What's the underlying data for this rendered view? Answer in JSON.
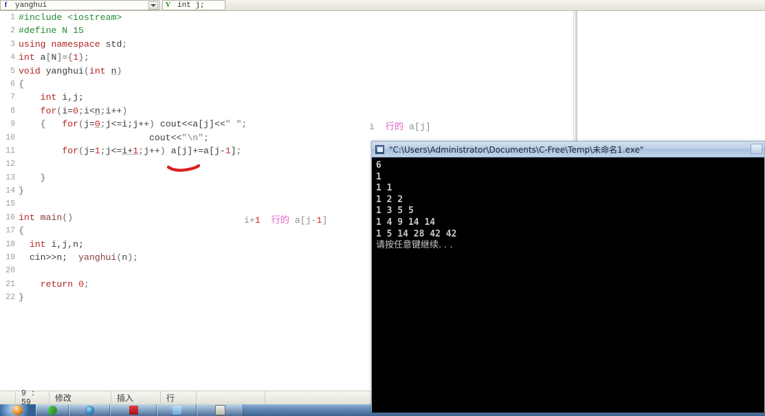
{
  "toolbar": {
    "function_combo": {
      "icon": "function-icon",
      "icon_glyph": "f",
      "value": "yanghui"
    },
    "declaration_combo": {
      "icon": "variable-icon",
      "icon_glyph": "V",
      "value": "int j;"
    },
    "dropdown_arrow": "chevron-down-icon"
  },
  "editor": {
    "lines": [
      {
        "num": "1",
        "html": "<span class='pre'>#include &lt;iostream&gt;</span>"
      },
      {
        "num": "2",
        "html": "<span class='pre'>#define N 15</span>"
      },
      {
        "num": "3",
        "html": "<span class='kw'>using namespace</span> <span class='id'>std</span><span class='pun'>;</span>"
      },
      {
        "num": "4",
        "html": "<span class='kw'>int</span> <span class='id'>a</span><span class='pun'>[</span><span class='id'>N</span><span class='pun'>]={</span><span class='num'>1</span><span class='pun'>};</span>"
      },
      {
        "num": "5",
        "html": "<span class='kw'>void</span> <span class='id'>yanghui</span><span class='pun'>(</span><span class='kw'>int</span> <span class='id und'>n</span><span class='pun'>)</span>"
      },
      {
        "num": "6",
        "html": "<span class='pun'>{</span>"
      },
      {
        "num": "7",
        "html": "    <span class='kw'>int</span> <span class='id'>i,j;</span>"
      },
      {
        "num": "8",
        "html": "    <span class='kw'>for</span><span class='pun'>(</span><span class='id'>i=</span><span class='num'>0</span><span class='pun'>;</span><span class='id'>i&lt;</span><span class='id und'>n</span><span class='pun'>;</span><span class='id'>i++</span><span class='pun'>)</span>"
      },
      {
        "num": "9",
        "html": "    <span class='pun'>{</span>   <span class='kw'>for</span><span class='pun'>(</span><span class='id'>j=</span><span class='num und'>0</span><span class='pun'>;</span><span class='id'>j&lt;=i;j++</span><span class='pun'>)</span> <span class='id'>cout&lt;&lt;a[j]&lt;&lt;</span><span class='str'>\" \"</span><span class='pun'>;</span>"
      },
      {
        "num": "10",
        "html": "                        <span class='id'>cout&lt;&lt;</span><span class='str'>\"\\n\"</span><span class='pun'>;</span>"
      },
      {
        "num": "11",
        "html": "        <span class='kw'>for</span><span class='pun'>(</span><span class='id'>j=</span><span class='num'>1</span><span class='pun'>;</span><span class='id'>j&lt;=</span><span class='id und'>i+</span><span class='num und'>1</span><span class='pun'>;</span><span class='id'>j++</span><span class='pun'>)</span> <span class='id'>a[j]+=a[j-</span><span class='num'>1</span><span class='id'>]</span><span class='pun'>;</span>"
      },
      {
        "num": "12",
        "html": ""
      },
      {
        "num": "13",
        "html": "    <span class='pun'>}</span>"
      },
      {
        "num": "14",
        "html": "<span class='pun'>}</span>"
      },
      {
        "num": "15",
        "html": ""
      },
      {
        "num": "16",
        "html": "<span class='kw'>int</span> <span class='fn'>main</span><span class='pun'>()</span>"
      },
      {
        "num": "17",
        "html": "<span class='pun'>{</span>"
      },
      {
        "num": "18",
        "html": "  <span class='kw'>int</span> <span class='id'>i,j,n;</span>"
      },
      {
        "num": "19",
        "html": "  <span class='id'>cin&gt;&gt;n;</span>  <span class='fn'>yanghui</span><span class='pun'>(</span><span class='id'>n</span><span class='pun'>);</span>"
      },
      {
        "num": "20",
        "html": ""
      },
      {
        "num": "21",
        "html": "    <span class='kw'>return</span> <span class='num'>0</span><span class='pun'>;</span>"
      },
      {
        "num": "22",
        "html": "<span class='pun'>}</span>"
      }
    ],
    "annotations": [
      {
        "name": "annotation-line9",
        "parts": [
          {
            "text": "i",
            "cls": "an-grey"
          },
          {
            "text": "  行的 ",
            "cls": "an-pink"
          },
          {
            "text": "a[j]",
            "cls": "an-grey"
          }
        ]
      },
      {
        "name": "annotation-line16",
        "parts": [
          {
            "text": "i+",
            "cls": "an-grey"
          },
          {
            "text": "1",
            "cls": "an-red"
          },
          {
            "text": "  行的 ",
            "cls": "an-pink"
          },
          {
            "text": "a[j-",
            "cls": "an-grey"
          },
          {
            "text": "1",
            "cls": "an-red"
          },
          {
            "text": "]",
            "cls": "an-grey"
          }
        ]
      }
    ],
    "red_underline_color": "#d92020"
  },
  "statusbar": {
    "position": "9 : 59",
    "modified": "修改",
    "insert_mode": "插入",
    "row_mode": "行",
    "blank": ""
  },
  "console": {
    "icon": "console-window-icon",
    "title": "\"C:\\Users\\Administrator\\Documents\\C-Free\\Temp\\未命名1.exe\"",
    "buttons": [
      "minimize-button"
    ],
    "output_lines": [
      "6",
      "1",
      "1 1",
      "1 2 2",
      "1 3 5 5",
      "1 4 9 14 14",
      "1 5 14 28 42 42"
    ],
    "prompt": "请按任意键继续. . ."
  },
  "taskbar": {
    "items": [
      {
        "name": "start-button",
        "icon": "windows-orb-icon"
      },
      {
        "name": "taskbar-item-1",
        "icon": "leaf-icon"
      },
      {
        "name": "taskbar-item-2",
        "icon": "internet-explorer-icon"
      },
      {
        "name": "taskbar-item-3",
        "icon": "pdf-reader-icon"
      },
      {
        "name": "taskbar-item-4",
        "icon": "folder-icon"
      },
      {
        "name": "taskbar-item-5",
        "icon": "application-icon"
      }
    ]
  },
  "colors": {
    "keyword": "#b22222",
    "preprocessor": "#1f8b2f",
    "number": "#cc2222",
    "annotation_pink": "#e060c8",
    "console_bg": "#000000",
    "titlebar": "#b9cce4"
  }
}
